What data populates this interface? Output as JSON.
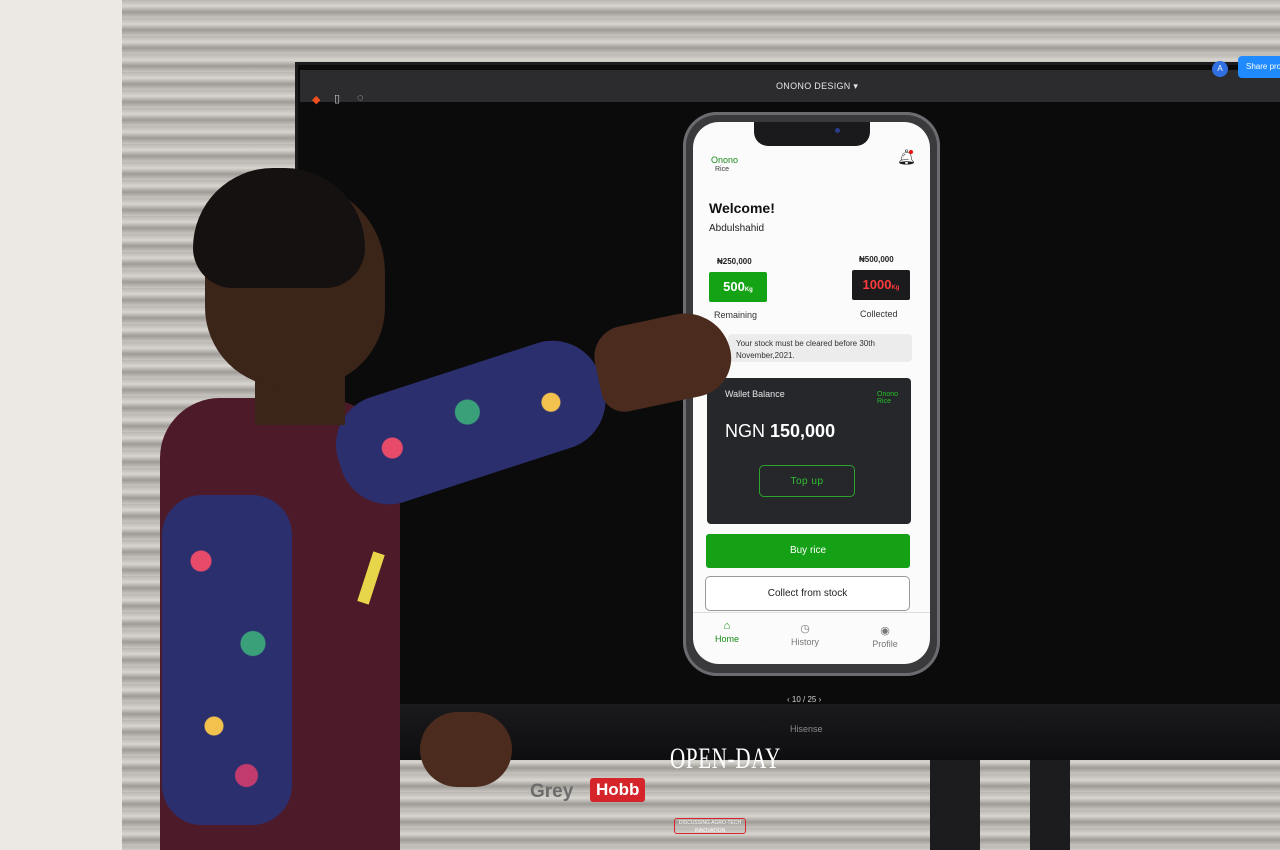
{
  "figma": {
    "file_title": "ONONO DESIGN",
    "avatar_initial": "A",
    "share_label": "Share pro",
    "page_indicator": "10 / 25"
  },
  "tv_brand": "Hisense",
  "app": {
    "logo_name": "Onono",
    "logo_sub": "Rice",
    "welcome": "Welcome!",
    "username": "Abdulshahid",
    "remaining": {
      "amount": "₦250,000",
      "value": "500",
      "unit": "Kg",
      "label": "Remaining"
    },
    "collected": {
      "amount": "₦500,000",
      "value": "1000",
      "unit": "Kg",
      "label": "Collected"
    },
    "notice": "Your stock must be cleared before 30th November,2021.",
    "wallet": {
      "label": "Wallet Balance",
      "currency": "NGN",
      "balance": "150,000",
      "topup_label": "Top up"
    },
    "buy_label": "Buy rice",
    "collect_label": "Collect from stock",
    "tabs": [
      {
        "label": "Home",
        "icon": "home-icon"
      },
      {
        "label": "History",
        "icon": "clock-icon"
      },
      {
        "label": "Profile",
        "icon": "user-icon"
      }
    ]
  },
  "event": {
    "grey": "Grey",
    "hobb": "Hobb",
    "open_day": "OPEN-DAY",
    "tagline": "DISCUSSING AGRO-TECH INNOVATION"
  },
  "colors": {
    "accent_green": "#15a115",
    "collected_red": "#ff3b3b",
    "wallet_bg": "#25272b"
  }
}
